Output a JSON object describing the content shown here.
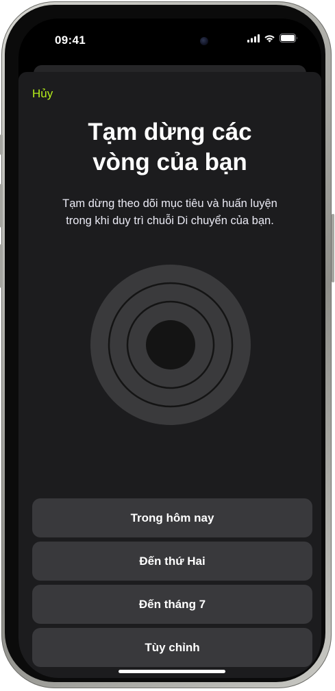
{
  "status_bar": {
    "time": "09:41",
    "icons": [
      "cellular-signal-icon",
      "wifi-icon",
      "battery-icon"
    ]
  },
  "sheet": {
    "cancel_label": "Hủy",
    "title_line1": "Tạm dừng các",
    "title_line2": "vòng của bạn",
    "subtitle_line1": "Tạm dừng theo dõi mục tiêu và huấn luyện",
    "subtitle_line2": "trong khi duy trì chuỗi Di chuyển của bạn."
  },
  "options": [
    {
      "label": "Trong hôm nay"
    },
    {
      "label": "Đến thứ Hai"
    },
    {
      "label": "Đến tháng 7"
    },
    {
      "label": "Tùy chỉnh"
    }
  ],
  "colors": {
    "accent": "#b7f01b",
    "sheet_background": "#1c1c1e",
    "button_background": "#39393c",
    "ring_fill": "#3a3a3c",
    "ring_stroke": "#141414"
  }
}
